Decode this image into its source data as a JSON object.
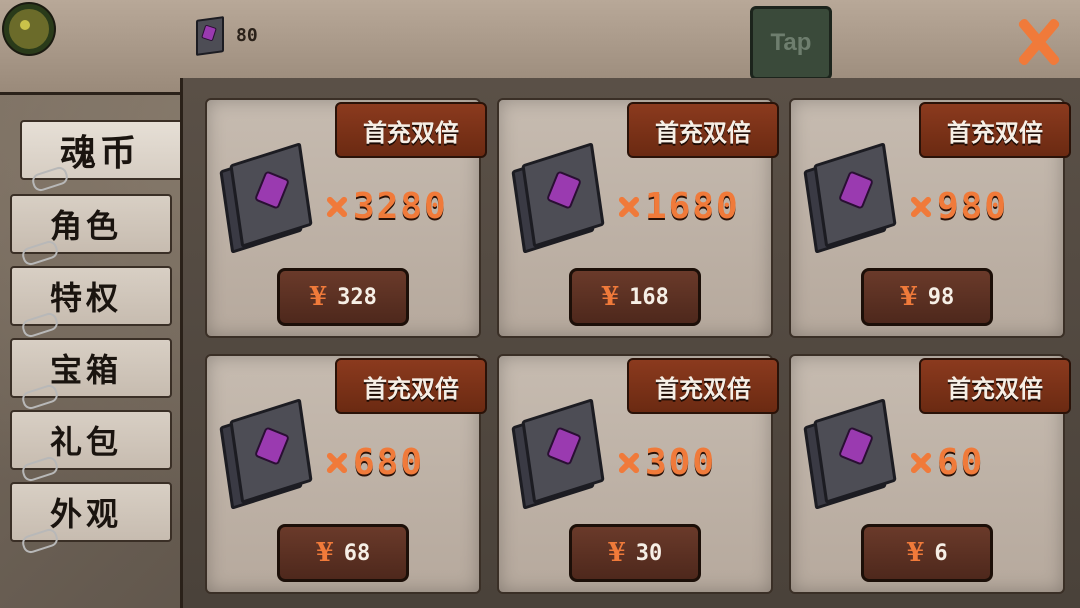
{
  "header": {
    "currency_count": "80",
    "tap_label": "Tap"
  },
  "sidebar": {
    "tabs": [
      {
        "label": "魂币",
        "selected": true
      },
      {
        "label": "角色",
        "selected": false
      },
      {
        "label": "特权",
        "selected": false
      },
      {
        "label": "宝箱",
        "selected": false
      },
      {
        "label": "礼包",
        "selected": false
      },
      {
        "label": "外观",
        "selected": false
      }
    ]
  },
  "shop": {
    "ribbon_text": "首充双倍",
    "currency_symbol": "¥",
    "items": [
      {
        "quantity": "3280",
        "price": "328"
      },
      {
        "quantity": "1680",
        "price": "168"
      },
      {
        "quantity": "980",
        "price": "98"
      },
      {
        "quantity": "680",
        "price": "68"
      },
      {
        "quantity": "300",
        "price": "30"
      },
      {
        "quantity": "60",
        "price": "6"
      }
    ]
  },
  "colors": {
    "accent_orange": "#f07a3a",
    "ribbon_red": "#8b3a1e",
    "gem_purple": "#9a3ab0"
  },
  "icons": {
    "timer": "timer-icon",
    "currency": "soul-book-icon",
    "close": "close-icon",
    "multiply": "multiply-icon"
  }
}
